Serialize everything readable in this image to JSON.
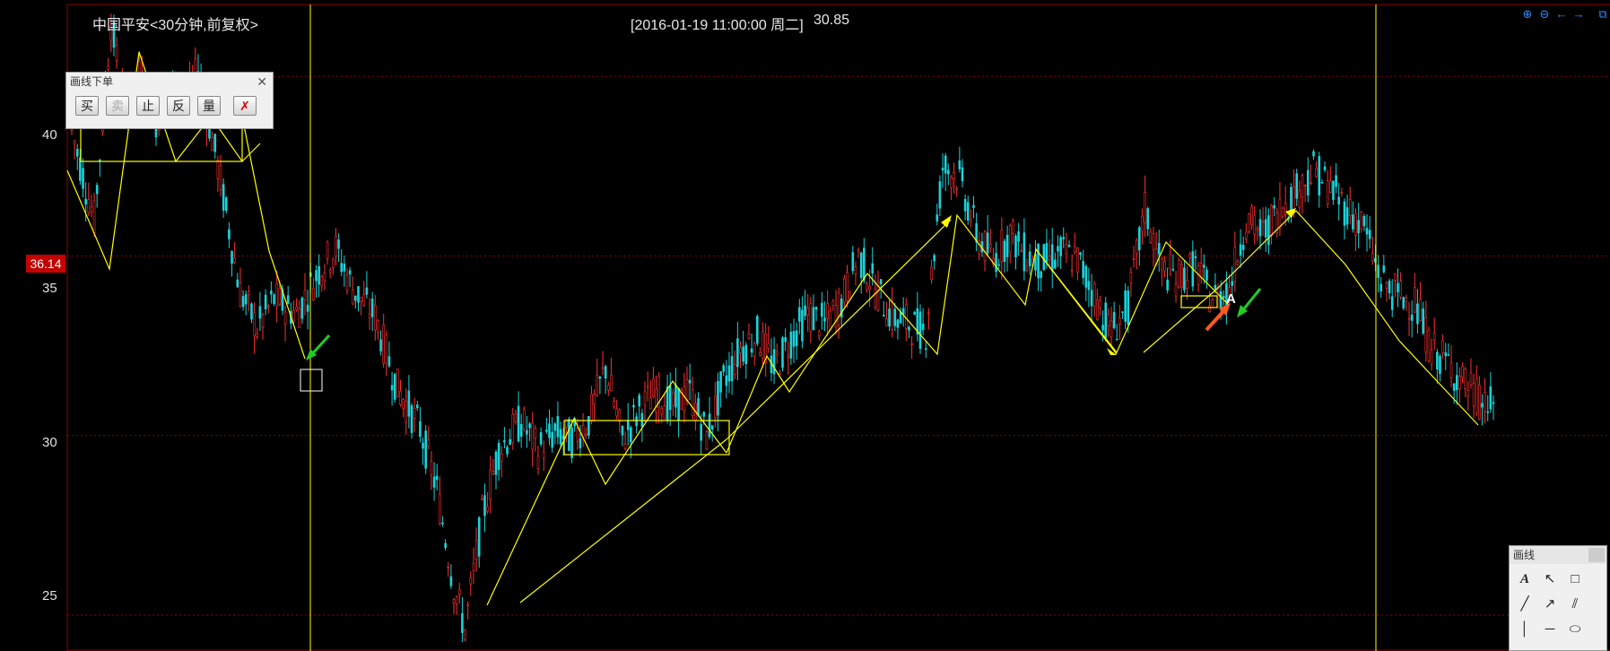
{
  "header": {
    "instrument_label": "中国平安<30分钟,前复权>",
    "cursor_datetime": "[2016-01-19  11:00:00 周二]",
    "cursor_price": "30.85"
  },
  "axis": {
    "y_ticks": [
      "40",
      "35",
      "30",
      "25"
    ],
    "current_price_tag": "36.14"
  },
  "order_panel": {
    "title": "画线下单",
    "buttons": [
      {
        "label": "买",
        "enabled": true
      },
      {
        "label": "卖",
        "enabled": false
      },
      {
        "label": "止",
        "enabled": true
      },
      {
        "label": "反",
        "enabled": true
      },
      {
        "label": "量",
        "enabled": true
      }
    ]
  },
  "draw_panel": {
    "title": "画线",
    "tools": [
      {
        "name": "text-tool",
        "glyph": "A"
      },
      {
        "name": "pointer-tool",
        "glyph": "↖"
      },
      {
        "name": "rectangle-tool",
        "glyph": "□"
      },
      {
        "name": "segment-tool",
        "glyph": "╱"
      },
      {
        "name": "ray-tool",
        "glyph": "↗"
      },
      {
        "name": "parallel-tool",
        "glyph": "⫽"
      },
      {
        "name": "vertical-line-tool",
        "glyph": "│"
      },
      {
        "name": "horizontal-line-tool",
        "glyph": "─"
      },
      {
        "name": "ellipse-tool",
        "glyph": "⬭"
      }
    ]
  },
  "top_right_icons": [
    "zoom-in-icon",
    "zoom-out-icon",
    "arrow-left-icon",
    "arrow-right-icon",
    "float-window-icon"
  ],
  "annotation_label": "A",
  "colors": {
    "background": "#000000",
    "up_candle": "#ff3030",
    "down_candle": "#19d3da",
    "drawing": "#ffff00",
    "grid": "#8b0000",
    "accent": "#2e8cff"
  },
  "chart_data": {
    "type": "candlestick",
    "ylim": [
      24,
      42
    ],
    "y_ticks": [
      25,
      30,
      35,
      40
    ],
    "price_path": [
      [
        0,
        38.5
      ],
      [
        8,
        36
      ],
      [
        14,
        41.5
      ],
      [
        19,
        39
      ],
      [
        24,
        40
      ],
      [
        30,
        38.8
      ],
      [
        36,
        39.8
      ],
      [
        41,
        39.2
      ],
      [
        45,
        40.2
      ],
      [
        52,
        37.5
      ],
      [
        60,
        34
      ],
      [
        66,
        33
      ],
      [
        72,
        33.8
      ],
      [
        80,
        33.4
      ],
      [
        88,
        34.6
      ],
      [
        94,
        35.2
      ],
      [
        100,
        34.1
      ],
      [
        108,
        33.3
      ],
      [
        116,
        31.3
      ],
      [
        124,
        30.2
      ],
      [
        130,
        28.5
      ],
      [
        136,
        25.8
      ],
      [
        140,
        24.6
      ],
      [
        146,
        27.7
      ],
      [
        152,
        29.6
      ],
      [
        160,
        30.4
      ],
      [
        166,
        29.6
      ],
      [
        172,
        30.1
      ],
      [
        178,
        29.9
      ],
      [
        184,
        30.4
      ],
      [
        190,
        31.9
      ],
      [
        196,
        29.9
      ],
      [
        202,
        30.7
      ],
      [
        208,
        31.2
      ],
      [
        214,
        30.8
      ],
      [
        220,
        31.2
      ],
      [
        226,
        30.0
      ],
      [
        232,
        31.5
      ],
      [
        238,
        32.4
      ],
      [
        244,
        32.8
      ],
      [
        250,
        31.9
      ],
      [
        256,
        32.7
      ],
      [
        262,
        33.4
      ],
      [
        268,
        33.1
      ],
      [
        274,
        33.7
      ],
      [
        280,
        35.0
      ],
      [
        286,
        34.1
      ],
      [
        292,
        33.3
      ],
      [
        298,
        33.1
      ],
      [
        304,
        32.9
      ],
      [
        310,
        37.5
      ],
      [
        316,
        37.2
      ],
      [
        322,
        35.6
      ],
      [
        328,
        34.9
      ],
      [
        334,
        35.6
      ],
      [
        340,
        35.0
      ],
      [
        346,
        34.8
      ],
      [
        352,
        35.1
      ],
      [
        358,
        34.9
      ],
      [
        364,
        33.9
      ],
      [
        370,
        32.9
      ],
      [
        376,
        33.6
      ],
      [
        382,
        36.3
      ],
      [
        388,
        34.6
      ],
      [
        394,
        34.4
      ],
      [
        400,
        34.7
      ],
      [
        406,
        33.8
      ],
      [
        412,
        34.1
      ],
      [
        418,
        36.0
      ],
      [
        424,
        35.6
      ],
      [
        430,
        36.3
      ],
      [
        436,
        36.8
      ],
      [
        442,
        37.4
      ],
      [
        448,
        36.9
      ],
      [
        454,
        36.3
      ],
      [
        460,
        35.8
      ],
      [
        466,
        34.3
      ],
      [
        472,
        33.9
      ],
      [
        478,
        33.7
      ],
      [
        484,
        32.4
      ],
      [
        490,
        32.0
      ],
      [
        496,
        31.4
      ],
      [
        502,
        30.9
      ],
      [
        506,
        30.8
      ]
    ]
  }
}
